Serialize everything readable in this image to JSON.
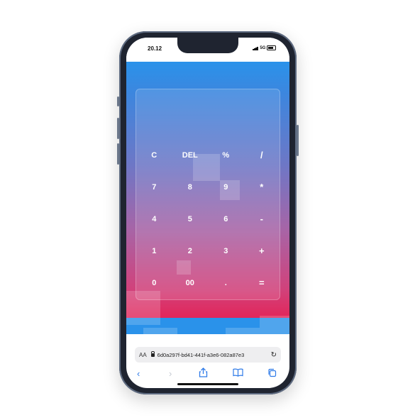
{
  "status_bar": {
    "time": "20.12",
    "network": "5G"
  },
  "calculator": {
    "keys": [
      {
        "label": "C",
        "name": "key-clear"
      },
      {
        "label": "DEL",
        "name": "key-delete"
      },
      {
        "label": "%",
        "name": "key-percent"
      },
      {
        "label": "/",
        "name": "key-divide"
      },
      {
        "label": "7",
        "name": "key-7"
      },
      {
        "label": "8",
        "name": "key-8"
      },
      {
        "label": "9",
        "name": "key-9"
      },
      {
        "label": "*",
        "name": "key-multiply"
      },
      {
        "label": "4",
        "name": "key-4"
      },
      {
        "label": "5",
        "name": "key-5"
      },
      {
        "label": "6",
        "name": "key-6"
      },
      {
        "label": "-",
        "name": "key-minus"
      },
      {
        "label": "1",
        "name": "key-1"
      },
      {
        "label": "2",
        "name": "key-2"
      },
      {
        "label": "3",
        "name": "key-3"
      },
      {
        "label": "+",
        "name": "key-plus"
      },
      {
        "label": "0",
        "name": "key-0"
      },
      {
        "label": "00",
        "name": "key-00"
      },
      {
        "label": ".",
        "name": "key-decimal"
      },
      {
        "label": "=",
        "name": "key-equals"
      }
    ]
  },
  "browser": {
    "aa_label": "AA",
    "url": "6d0a297f-bd41-441f-a3e6-082a87e3",
    "reload_icon": "reload-icon",
    "toolbar": {
      "back_icon": "chevron-left-icon",
      "forward_icon": "chevron-right-icon",
      "share_icon": "share-icon",
      "bookmarks_icon": "book-icon",
      "tabs_icon": "tabs-icon"
    }
  },
  "colors": {
    "gradient_top": "#2a92ea",
    "gradient_mid": "#a864a6",
    "gradient_bottom": "#e2265a",
    "toolbar_accent": "#2f7be8"
  }
}
